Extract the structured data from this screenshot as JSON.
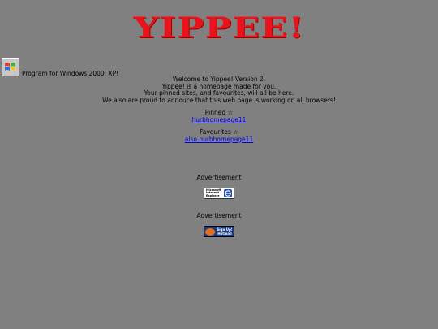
{
  "header": {
    "logo_text": "YIPPEE!"
  },
  "program": {
    "icon": "windows-flag-icon",
    "text": "Program for Windows 2000, XP!"
  },
  "welcome": {
    "lines": [
      "Welcome to Yippee! Version 2.",
      "Yippee! is a homepage made for you.",
      "Your pinned sites, and favourites, will all be here.",
      "We also are proud to annouce that this web page is working on all browsers!"
    ]
  },
  "pinned": {
    "label": "Pinned ☆",
    "link": "hurbhomepage11"
  },
  "favourites": {
    "label": "Favourites ☆",
    "link": "also hurbhomepage11"
  },
  "ads": [
    {
      "label": "Advertisement",
      "badge_lines": [
        "Microsoft",
        "Internet",
        "Explorer"
      ],
      "badge_icon": "internet-explorer-icon"
    },
    {
      "label": "Advertisement",
      "badge_lines": [
        "Sign Up!",
        "Hotmail"
      ],
      "badge_icon": "msn-butterfly-icon"
    }
  ],
  "colors": {
    "background": "#808080",
    "logo": "#e8141b",
    "link": "#0000ee"
  }
}
